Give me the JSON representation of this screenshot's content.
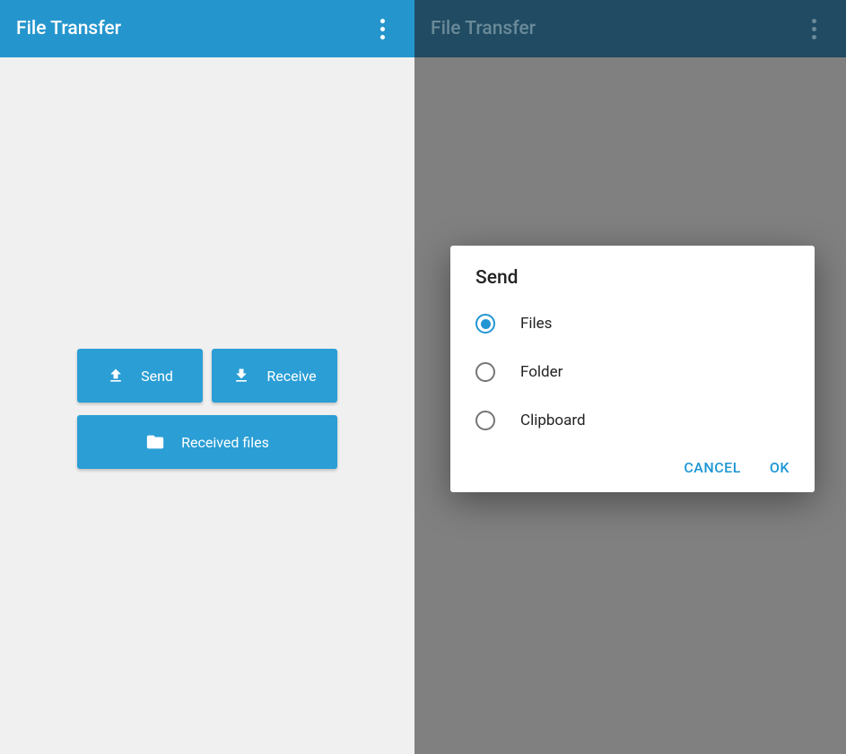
{
  "left": {
    "appbar": {
      "title": "File Transfer"
    },
    "buttons": {
      "send": "Send",
      "receive": "Receive",
      "received_files": "Received files"
    }
  },
  "right": {
    "appbar": {
      "title": "File Transfer"
    },
    "dialog": {
      "title": "Send",
      "options": {
        "files": "Files",
        "folder": "Folder",
        "clipboard": "Clipboard"
      },
      "selected": "files",
      "actions": {
        "cancel": "CANCEL",
        "ok": "OK"
      }
    }
  }
}
